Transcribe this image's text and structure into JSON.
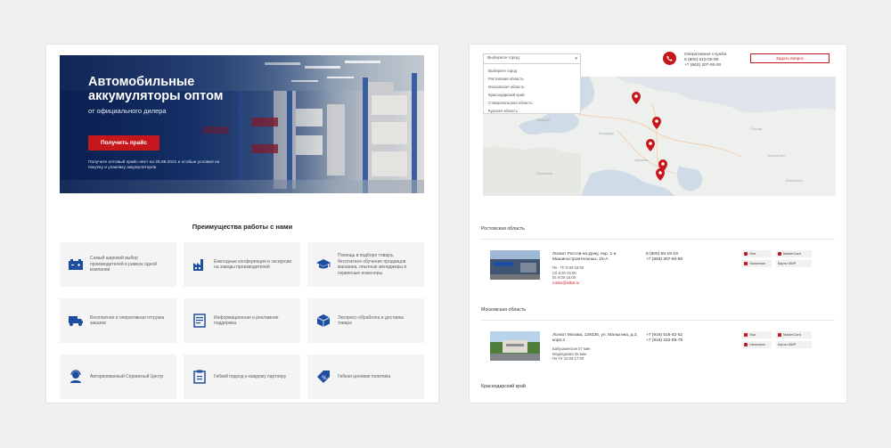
{
  "left": {
    "hero": {
      "title": "Автомобильные аккумуляторы оптом",
      "subtitle": "от официального дилера",
      "button": "Получить прайс",
      "note": "Получите оптовый прайс-лист на 25.08.2021 и особые условия на покупку и упаковку аккумуляторов"
    },
    "advantages_title": "Преимущества работы с нами",
    "advantages": [
      {
        "icon": "battery-icon",
        "text": "Самый широкий выбор производителей в рамках одной компании"
      },
      {
        "icon": "factory-icon",
        "text": "Ежегодные конференции и экскурсии на заводы производителей"
      },
      {
        "icon": "graduation-cap-icon",
        "text": "Помощь в подборе товара, бесплатное обучение продавцов магазина, опытные менеджеры и сервисные инженеры"
      },
      {
        "icon": "truck-icon",
        "text": "Бесплатная и оперативная отгрузка заказов"
      },
      {
        "icon": "document-icon",
        "text": "Информационная и рекламная поддержка"
      },
      {
        "icon": "box-icon",
        "text": "Экспресс-обработка и доставка товара"
      },
      {
        "icon": "support-agent-icon",
        "text": "Авторизованный Сервисный Центр"
      },
      {
        "icon": "checklist-icon",
        "text": "Гибкий подход к каждому партнеру"
      },
      {
        "icon": "price-tag-icon",
        "text": "Гибкая ценовая политика"
      }
    ]
  },
  "right": {
    "city_select": {
      "placeholder": "Выберите город",
      "options": [
        "Выберите город",
        "Ростовская область",
        "Московская область",
        "Краснодарский край",
        "Ставропольская область",
        "Курская область"
      ]
    },
    "hotline": {
      "label": "Оперативная служба",
      "phone1": "8 (800) 510-00-90",
      "phone2": "+7 (863) 207-00-00"
    },
    "ask_button": "Задать вопрос",
    "regions": [
      {
        "name": "Ростовская область",
        "store": {
          "address": "Лолкот Ростов-на-Дону, пер. 1-я Машиностроительных, 15-А",
          "hours1": "Пн - Пт 8:30-18:00",
          "hours2": "Сб 8:30-15:00",
          "hours3": "Вс 9:00-15:00",
          "email": "rostov@lolkot.ru",
          "phone1": "8 (800) 55-19-19",
          "phone2": "+7 (863) 307-80-80"
        }
      },
      {
        "name": "Московская область",
        "store": {
          "address": "Лолкот Москва, 129336, ул. Малыгина, д.2, корп.2",
          "metro1": "Бабушкинская 27 мин",
          "metro2": "Медведково 25 мин",
          "hours1": "Пн-Пт 10:00-17:00",
          "phone1": "+7 (916) 516-42-52",
          "phone2": "+7 (916) 310-65-75"
        }
      },
      {
        "name": "Краснодарский край"
      }
    ],
    "payments": [
      "Visa",
      "MasterCard",
      "Наличные",
      "Карты МИР"
    ]
  },
  "colors": {
    "brand_red": "#c5171c",
    "brand_blue": "#1e4ea1",
    "hero_dark": "#0e2a5c"
  }
}
